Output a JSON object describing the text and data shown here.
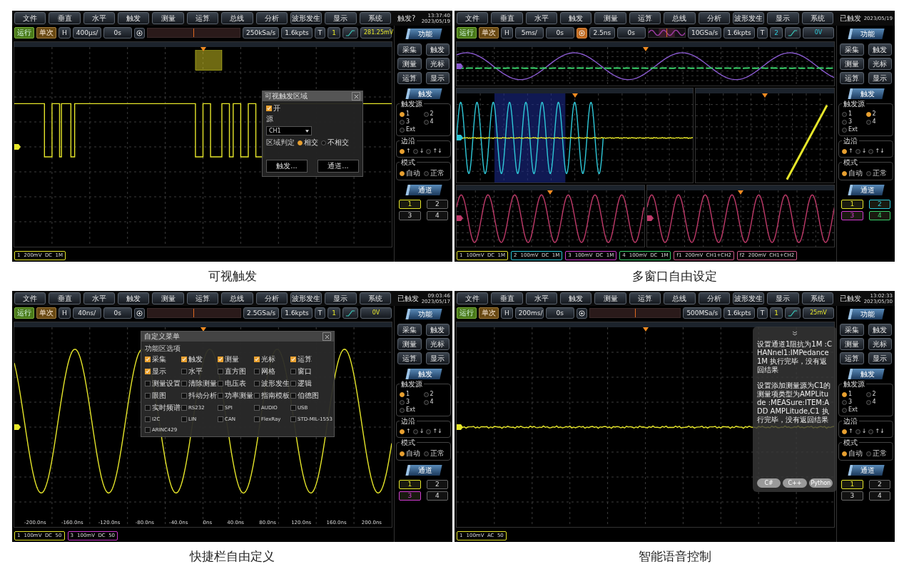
{
  "panels": [
    {
      "caption": "可视触发",
      "screen": {
        "menu": [
          "文件",
          "垂直",
          "水平",
          "触发",
          "测量",
          "运算",
          "总线",
          "分析",
          "波形发生",
          "显示",
          "系统"
        ],
        "status": "触发?",
        "time": "13:37:40",
        "date": "2023/05/19",
        "toolbar": {
          "run": "运行",
          "single": "单次",
          "h": "H",
          "timebase": "400μs/",
          "offset": "0s",
          "zoom": {
            "on": false
          },
          "overview": {
            "kind": "bar"
          },
          "sample_rate": "250kSa/s",
          "points": "1.6kpts",
          "t": "T",
          "source": "1",
          "level": "281.25mV"
        },
        "rows": [
          [
            {
              "traces": [
                {
                  "kind": "pulse",
                  "color": "#e6e62a"
                }
              ],
              "highlight": {
                "kind": "trigger-region"
              }
            }
          ]
        ],
        "channel_bar": [
          {
            "label": "1",
            "setting": "200mV  DC  1M",
            "color": "#e6e62a"
          }
        ],
        "dialog": {
          "kind": "visual-trigger",
          "title": "可视触发区域",
          "enable": {
            "label": "开",
            "checked": true
          },
          "source_label": "源",
          "source_value": "CH1",
          "region_label": "区域判定",
          "options": [
            {
              "label": "相交",
              "selected": true
            },
            {
              "label": "不相交",
              "selected": false
            }
          ],
          "buttons": [
            "触发...",
            "通道..."
          ]
        },
        "sidebar": {
          "function_tab": "功能",
          "function_buttons": [
            "采集",
            "触发",
            "测量",
            "光标",
            "运算",
            "显示"
          ],
          "trigger_tab": "触发",
          "source_group": "触发源",
          "sources": [
            {
              "label": "1",
              "selected": true
            },
            {
              "label": "2",
              "selected": false
            },
            {
              "label": "3",
              "selected": false
            },
            {
              "label": "4",
              "selected": false
            },
            {
              "label": "Ext",
              "selected": false
            }
          ],
          "edge_group": "边沿",
          "edges": [
            {
              "label": "↑",
              "selected": true
            },
            {
              "label": "↓",
              "selected": false
            },
            {
              "label": "↑↓",
              "selected": false
            }
          ],
          "mode_group": "模式",
          "modes": [
            {
              "label": "自动",
              "selected": true
            },
            {
              "label": "正常",
              "selected": false
            }
          ],
          "channel_tab": "通道",
          "channels": [
            {
              "label": "1",
              "on": true,
              "color": "#e6e62a"
            },
            {
              "label": "2",
              "on": false
            },
            {
              "label": "3",
              "on": false
            },
            {
              "label": "4",
              "on": false
            }
          ]
        }
      }
    },
    {
      "caption": "多窗口自由设定",
      "screen": {
        "menu": [
          "文件",
          "垂直",
          "水平",
          "触发",
          "测量",
          "运算",
          "总线",
          "分析",
          "波形发生",
          "显示",
          "系统"
        ],
        "status": "已触发",
        "date": "2023/05/19",
        "toolbar": {
          "run": "运行",
          "single": "单次",
          "h": "H",
          "timebase": "5ms/",
          "offset": "0s",
          "zoom": {
            "on": true,
            "scale": "2.5ns",
            "offset": "0s"
          },
          "overview": {
            "kind": "wave"
          },
          "sample_rate": "10GSa/s",
          "points": "1.6kpts",
          "t": "T",
          "source": "2",
          "level": "0V"
        },
        "rows": [
          [
            {
              "traces": [
                {
                  "kind": "sine-overview",
                  "color": "#8a5ad0"
                },
                {
                  "kind": "flat-dotted",
                  "color": "#3ad06a"
                }
              ]
            }
          ],
          [
            {
              "traces": [
                {
                  "kind": "sine-main",
                  "color": "#2ec8d8"
                },
                {
                  "kind": "flat",
                  "color": "#e6e62a"
                }
              ],
              "highlight": {
                "kind": "zoom-region"
              }
            },
            {
              "traces": [
                {
                  "kind": "xy",
                  "color": "#e6e62a"
                }
              ]
            }
          ],
          [
            {
              "traces": [
                {
                  "kind": "sine-small",
                  "color": "#c03a6a"
                }
              ]
            },
            {
              "traces": [
                {
                  "kind": "sine-small",
                  "color": "#c03a6a"
                }
              ]
            }
          ]
        ],
        "channel_bar": [
          {
            "label": "1",
            "setting": "100mV  DC  1M",
            "color": "#e6e62a"
          },
          {
            "label": "2",
            "setting": "100mV  DC  1M",
            "color": "#2ec8d8"
          },
          {
            "label": "3",
            "setting": "100mV  DC  1M",
            "color": "#d03ad0"
          },
          {
            "label": "4",
            "setting": "100mV  DC  1M",
            "color": "#3ad06a"
          },
          {
            "label": "f1",
            "setting": "200mV  CH1+CH2",
            "color": "#d05a8a"
          },
          {
            "label": "f2",
            "setting": "200mV  CH1+CH2",
            "color": "#d05a8a"
          }
        ],
        "sidebar": {
          "function_tab": "功能",
          "function_buttons": [
            "采集",
            "触发",
            "测量",
            "光标",
            "运算",
            "显示"
          ],
          "trigger_tab": "触发",
          "source_group": "触发源",
          "sources": [
            {
              "label": "1",
              "selected": false
            },
            {
              "label": "2",
              "selected": true
            },
            {
              "label": "3",
              "selected": false
            },
            {
              "label": "4",
              "selected": false
            },
            {
              "label": "Ext",
              "selected": false
            }
          ],
          "edge_group": "边沿",
          "edges": [
            {
              "label": "↑",
              "selected": true
            },
            {
              "label": "↓",
              "selected": false
            },
            {
              "label": "↑↓",
              "selected": false
            }
          ],
          "mode_group": "模式",
          "modes": [
            {
              "label": "自动",
              "selected": true
            },
            {
              "label": "正常",
              "selected": false
            }
          ],
          "channel_tab": "通道",
          "channels": [
            {
              "label": "1",
              "on": true,
              "color": "#e6e62a"
            },
            {
              "label": "2",
              "on": true,
              "color": "#2ec8d8"
            },
            {
              "label": "3",
              "on": true,
              "color": "#d03ad0"
            },
            {
              "label": "4",
              "on": true,
              "color": "#3ad06a"
            }
          ]
        }
      }
    },
    {
      "caption": "快捷栏自由定义",
      "screen": {
        "menu": [
          "文件",
          "垂直",
          "水平",
          "触发",
          "测量",
          "运算",
          "总线",
          "分析",
          "波形发生",
          "显示",
          "系统"
        ],
        "status": "已触发",
        "time": "09:03:46",
        "date": "2023/05/17",
        "toolbar": {
          "run": "运行",
          "single": "单次",
          "h": "H",
          "timebase": "40ns/",
          "offset": "0s",
          "zoom": {
            "on": false
          },
          "overview": {
            "kind": "bar"
          },
          "sample_rate": "2.5GSa/s",
          "points": "1.6kpts",
          "t": "T",
          "source": "1",
          "level": "0V"
        },
        "rows": [
          [
            {
              "traces": [
                {
                  "kind": "sine-large",
                  "color": "#e6e62a"
                }
              ],
              "time_labels": [
                "-200.0ns",
                "-160.0ns",
                "-120.0ns",
                "-80.0ns",
                "-40.0ns",
                "0ns",
                "40.0ns",
                "80.0ns",
                "120.0ns",
                "160.0ns",
                "200.0ns"
              ]
            }
          ]
        ],
        "channel_bar": [
          {
            "label": "1",
            "setting": "100mV  DC  50",
            "color": "#e6e62a"
          },
          {
            "label": "3",
            "setting": "100mV  DC  50",
            "color": "#d03ad0"
          }
        ],
        "dialog": {
          "kind": "custom-menu",
          "title": "自定义菜单",
          "subtitle": "功能区选项",
          "items": [
            {
              "label": "采集",
              "checked": true
            },
            {
              "label": "触发",
              "checked": true
            },
            {
              "label": "测量",
              "checked": true
            },
            {
              "label": "光标",
              "checked": true
            },
            {
              "label": "运算",
              "checked": true
            },
            {
              "label": "显示",
              "checked": true
            },
            {
              "label": "水平",
              "checked": false
            },
            {
              "label": "直方图",
              "checked": false
            },
            {
              "label": "网格",
              "checked": false
            },
            {
              "label": "窗口",
              "checked": false
            },
            {
              "label": "测量设置",
              "checked": false
            },
            {
              "label": "清除测量",
              "checked": false
            },
            {
              "label": "电压表",
              "checked": false
            },
            {
              "label": "波形发生",
              "checked": false
            },
            {
              "label": "逻辑",
              "checked": false
            },
            {
              "label": "眼图",
              "checked": false
            },
            {
              "label": "抖动分析",
              "checked": false
            },
            {
              "label": "功率测量",
              "checked": false
            },
            {
              "label": "指南模板",
              "checked": false
            },
            {
              "label": "伯德图",
              "checked": false
            },
            {
              "label": "实时频谱",
              "checked": false
            },
            {
              "label": "RS232",
              "checked": false
            },
            {
              "label": "SPI",
              "checked": false
            },
            {
              "label": "AUDIO",
              "checked": false
            },
            {
              "label": "USB",
              "checked": false
            },
            {
              "label": "I2C",
              "checked": false
            },
            {
              "label": "LIN",
              "checked": false
            },
            {
              "label": "CAN",
              "checked": false
            },
            {
              "label": "FlexRay",
              "checked": false
            },
            {
              "label": "STD-MIL-1553",
              "checked": false
            },
            {
              "label": "ARINC429",
              "checked": false
            }
          ]
        },
        "sidebar": {
          "function_tab": "功能",
          "function_buttons": [
            "采集",
            "触发",
            "测量",
            "光标",
            "运算",
            "显示"
          ],
          "trigger_tab": "触发",
          "source_group": "触发源",
          "sources": [
            {
              "label": "1",
              "selected": true
            },
            {
              "label": "2",
              "selected": false
            },
            {
              "label": "3",
              "selected": false
            },
            {
              "label": "4",
              "selected": false
            },
            {
              "label": "Ext",
              "selected": false
            }
          ],
          "edge_group": "边沿",
          "edges": [
            {
              "label": "↑",
              "selected": true
            },
            {
              "label": "↓",
              "selected": false
            },
            {
              "label": "↑↓",
              "selected": false
            }
          ],
          "mode_group": "模式",
          "modes": [
            {
              "label": "自动",
              "selected": true
            },
            {
              "label": "正常",
              "selected": false
            }
          ],
          "channel_tab": "通道",
          "channels": [
            {
              "label": "1",
              "on": true,
              "color": "#e6e62a"
            },
            {
              "label": "2",
              "on": false
            },
            {
              "label": "3",
              "on": true,
              "color": "#d03ad0"
            },
            {
              "label": "4",
              "on": false
            }
          ]
        }
      }
    },
    {
      "caption": "智能语音控制",
      "screen": {
        "menu": [
          "文件",
          "垂直",
          "水平",
          "触发",
          "测量",
          "运算",
          "总线",
          "分析",
          "波形发生",
          "显示",
          "系统"
        ],
        "status": "已触发",
        "time": "13:02:33",
        "date": "2023/05/30",
        "toolbar": {
          "run": "运行",
          "single": "单次",
          "h": "H",
          "timebase": "200ms/",
          "offset": "0s",
          "zoom": {
            "on": false
          },
          "overview": {
            "kind": "bar"
          },
          "sample_rate": "500MSa/s",
          "points": "1.6kpts",
          "t": "T",
          "source": "1",
          "level": "25mV"
        },
        "rows": [
          [
            {
              "traces": [
                {
                  "kind": "flat",
                  "color": "#e6e62a"
                }
              ]
            }
          ]
        ],
        "channel_bar": [
          {
            "label": "1",
            "setting": "100mV  AC  50",
            "color": "#e6e62a"
          }
        ],
        "dialog": {
          "kind": "voice",
          "messages": [
            "设置通道1阻抗为1M :CHANnel1:IMPedance 1M 执行完毕，没有返回结果",
            "设置添加测量源为C1的测量项类型为AMPLitude :MEASure:ITEM:ADD AMPLitude,C1 执行完毕，没有返回结果"
          ],
          "buttons": [
            "C#",
            "C++",
            "Python"
          ]
        },
        "sidebar": {
          "function_tab": "功能",
          "function_buttons": [
            "采集",
            "触发",
            "测量",
            "光标",
            "运算",
            "显示"
          ],
          "trigger_tab": "触发",
          "source_group": "触发源",
          "sources": [
            {
              "label": "1",
              "selected": true
            },
            {
              "label": "2",
              "selected": false
            },
            {
              "label": "3",
              "selected": false
            },
            {
              "label": "4",
              "selected": false
            },
            {
              "label": "Ext",
              "selected": false
            }
          ],
          "edge_group": "边沿",
          "edges": [
            {
              "label": "↑",
              "selected": true
            },
            {
              "label": "↓",
              "selected": false
            },
            {
              "label": "↑↓",
              "selected": false
            }
          ],
          "mode_group": "模式",
          "modes": [
            {
              "label": "自动",
              "selected": true
            },
            {
              "label": "正常",
              "selected": false
            }
          ],
          "channel_tab": "通道",
          "channels": [
            {
              "label": "1",
              "on": true,
              "color": "#e6e62a"
            },
            {
              "label": "2",
              "on": false
            },
            {
              "label": "3",
              "on": false
            },
            {
              "label": "4",
              "on": false
            }
          ]
        }
      }
    }
  ]
}
